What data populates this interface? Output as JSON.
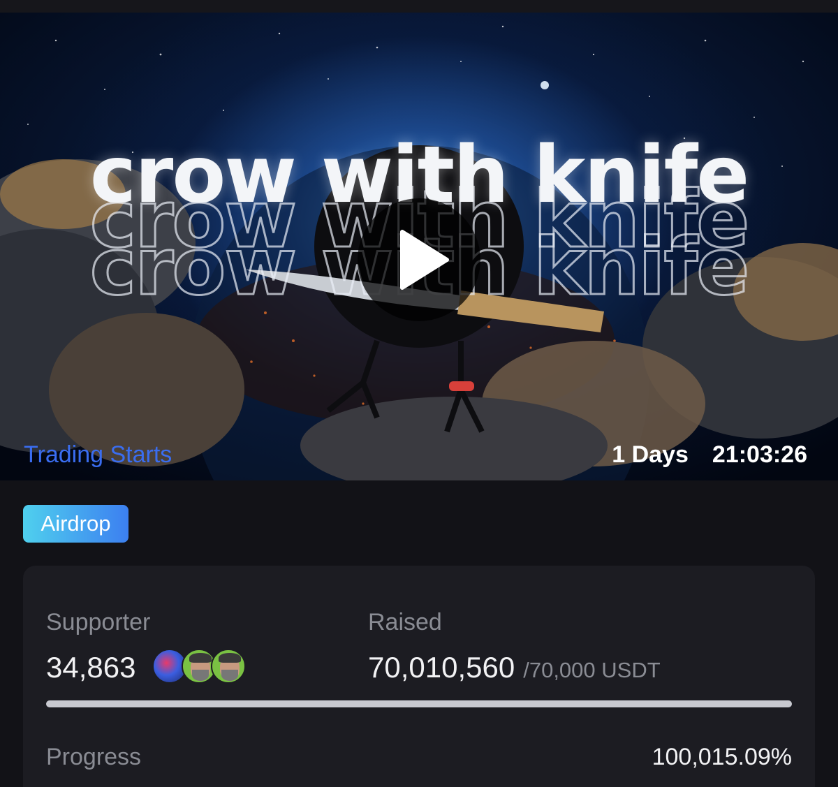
{
  "hero": {
    "title": "crow with knife",
    "trading_label": "Trading Starts",
    "countdown_days": "1 Days",
    "countdown_time": "21:03:26"
  },
  "badge": {
    "label": "Airdrop"
  },
  "stats": {
    "supporter_label": "Supporter",
    "supporter_count": "34,863",
    "raised_label": "Raised",
    "raised_value": "70,010,560",
    "raised_target": "/70,000 USDT",
    "progress_label": "Progress",
    "progress_value": "100,015.09%",
    "progress_fraction": 1.0
  },
  "colors": {
    "trading_label": "#3a6df0",
    "badge_gradient_start": "#4fd0ee",
    "badge_gradient_end": "#3c7ff0",
    "card_background": "#1c1c22",
    "progress_fill": "#c8c9d0"
  },
  "icons": {
    "play": "play-icon",
    "avatars": [
      "avatar-icon",
      "avatar-icon",
      "avatar-icon"
    ]
  }
}
